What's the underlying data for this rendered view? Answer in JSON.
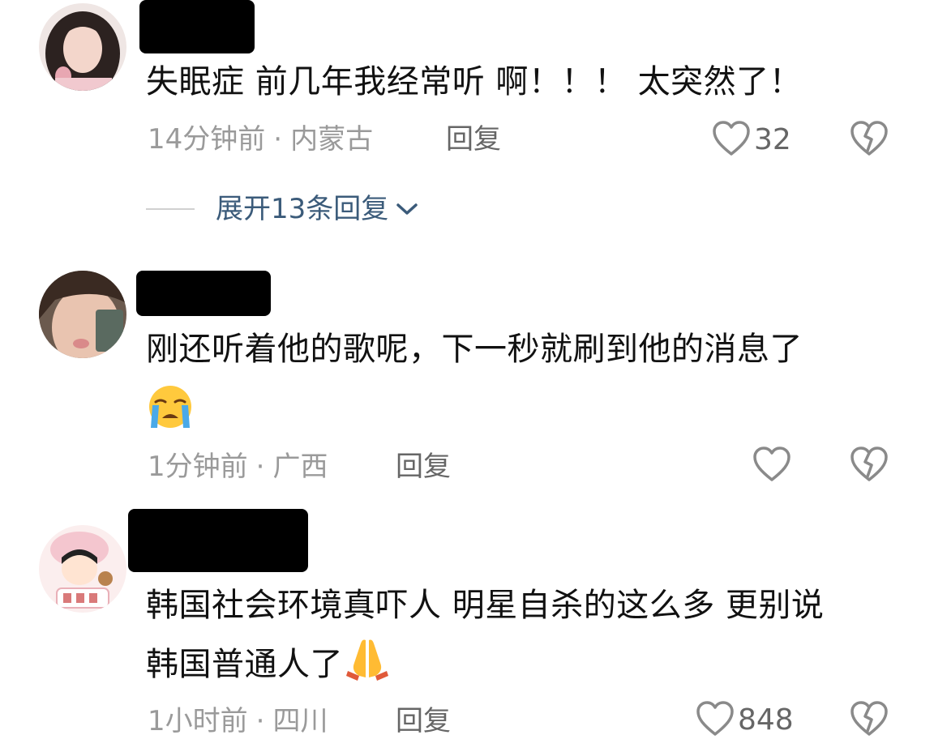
{
  "comments": [
    {
      "text": "失眠症 前几年我经常听  啊！！！ 太突然了！",
      "time": "14分钟前",
      "location": "内蒙古",
      "reply_label": "回复",
      "likes": "32"
    },
    {
      "text_line1": "刚还听着他的歌呢，下一秒就刷到他的消息了",
      "emoji": "crying-face",
      "time": "1分钟前",
      "location": "广西",
      "reply_label": "回复",
      "likes": ""
    },
    {
      "text_line1": "韩国社会环境真吓人 明星自杀的这么多 更别说",
      "text_line2": "韩国普通人了",
      "emoji": "folded-hands",
      "time": "1小时前",
      "location": "四川",
      "reply_label": "回复",
      "likes": "848"
    }
  ],
  "expand_replies": "展开13条回复",
  "separator": "·",
  "colors": {
    "meta": "#9a9a9a",
    "link": "#3b5b7a",
    "icon": "#8a8a8a"
  }
}
